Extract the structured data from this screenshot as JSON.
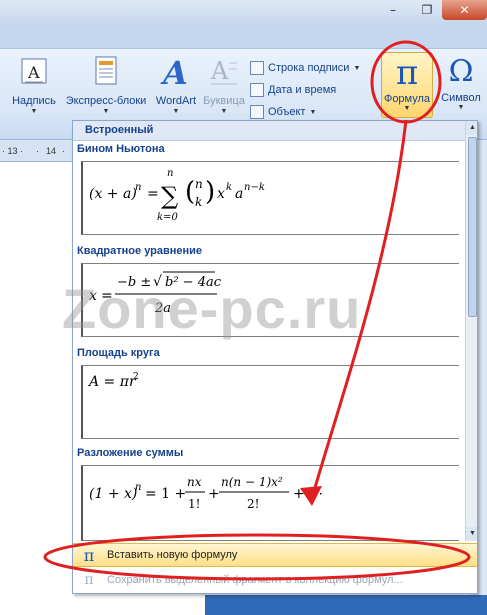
{
  "window": {
    "minimize": "–",
    "maximize": "❐",
    "close": "✕",
    "help": "?"
  },
  "ribbon": {
    "buttons": [
      {
        "label": "Надпись",
        "icon": "textbox-icon"
      },
      {
        "label": "Экспресс-блоки",
        "icon": "quickparts-icon"
      },
      {
        "label": "WordArt",
        "icon": "wordart-icon"
      },
      {
        "label": "Буквица",
        "icon": "dropcap-icon"
      }
    ],
    "small": [
      {
        "label": "Строка подписи",
        "icon": "signature-line-icon"
      },
      {
        "label": "Дата и время",
        "icon": "date-time-icon"
      },
      {
        "label": "Объект",
        "icon": "object-icon"
      }
    ],
    "formula": {
      "label": "Формула",
      "glyph": "π"
    },
    "symbol": {
      "label": "Символ",
      "glyph": "Ω"
    }
  },
  "ruler": {
    "ticks": [
      "· 13 ·",
      "·",
      "14",
      "·"
    ]
  },
  "gallery": {
    "header": "Встроенный",
    "sections": [
      {
        "title": "Бином Ньютона",
        "equation": "(x + a)ⁿ = Σ C(n,k) xᵏ aⁿ⁻ᵏ"
      },
      {
        "title": "Квадратное уравнение",
        "equation": "x = (−b ± √(b² − 4ac)) / 2a"
      },
      {
        "title": "Площадь круга",
        "equation": "A = πr²"
      },
      {
        "title": "Разложение суммы",
        "equation": "(1 + x)ⁿ = 1 + nx/1! + n(n−1)x²/2! + ⋯"
      }
    ],
    "insert_label": "Вставить новую формулу",
    "save_label": "Сохранить выделенный фрагмент в коллекцию формул..."
  },
  "watermark": "Zone-pc.ru",
  "colors": {
    "accent": "#1a56b8",
    "annotation": "#e02020",
    "highlight": "#ffdf86"
  }
}
